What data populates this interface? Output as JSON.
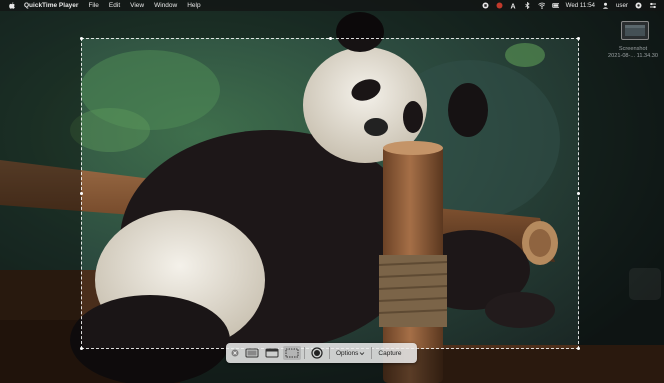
{
  "menubar": {
    "app_name": "QuickTime Player",
    "menus": [
      "File",
      "Edit",
      "View",
      "Window",
      "Help"
    ],
    "datetime": "Wed 11:54",
    "user": "user"
  },
  "thumbnail": {
    "label_line1": "Screenshot",
    "label_line2": "2021-08-... 11.34.30"
  },
  "toolbar": {
    "options_label": "Options",
    "capture_label": "Capture"
  },
  "colors": {
    "accent": "#ffffff",
    "toolbar_bg": "#ececec",
    "menubar_bg": "#121414"
  },
  "icons": [
    "apple-icon",
    "close-icon",
    "capture-entire-screen-icon",
    "capture-window-icon",
    "capture-selection-icon",
    "record-icon",
    "chevron-down-icon"
  ]
}
